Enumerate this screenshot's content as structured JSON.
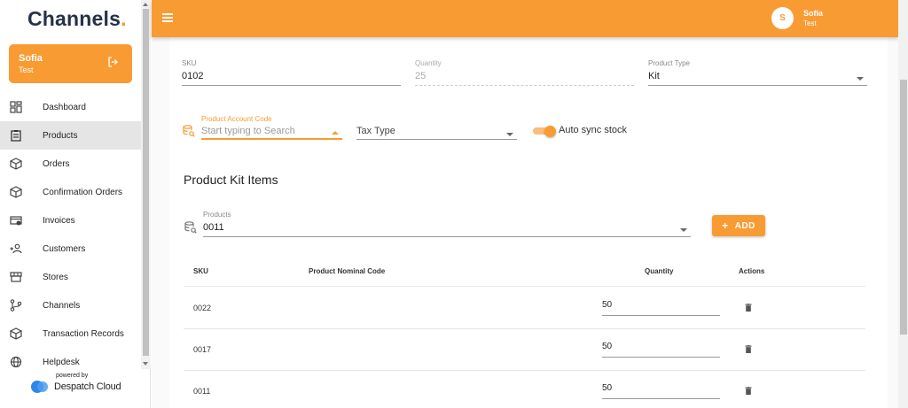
{
  "brand": {
    "name": "Channels",
    "dot": "."
  },
  "user_card": {
    "name": "Sofia",
    "subtitle": "Test"
  },
  "nav": {
    "items": [
      {
        "label": "Dashboard",
        "icon": "dashboard-icon"
      },
      {
        "label": "Products",
        "icon": "clipboard-icon",
        "active": true
      },
      {
        "label": "Orders",
        "icon": "box-icon"
      },
      {
        "label": "Confirmation Orders",
        "icon": "box-icon"
      },
      {
        "label": "Invoices",
        "icon": "invoice-icon"
      },
      {
        "label": "Customers",
        "icon": "add-user-icon"
      },
      {
        "label": "Stores",
        "icon": "store-icon"
      },
      {
        "label": "Channels",
        "icon": "branch-icon"
      },
      {
        "label": "Transaction Records",
        "icon": "box-icon"
      },
      {
        "label": "Helpdesk",
        "icon": "globe-icon"
      }
    ]
  },
  "powered_by": {
    "label": "powered by",
    "brand": "Despatch Cloud"
  },
  "header": {
    "avatar_letter": "S",
    "user_name": "Sofia",
    "user_sub": "Test"
  },
  "form": {
    "sku": {
      "label": "SKU",
      "value": "0102"
    },
    "quantity": {
      "label": "Quantity",
      "value": "25"
    },
    "product_type": {
      "label": "Product Type",
      "value": "Kit"
    },
    "product_account_code": {
      "label": "Product Account Code",
      "placeholder": "Start typing to Search"
    },
    "tax_type": {
      "placeholder": "Tax Type"
    },
    "auto_sync": {
      "label": "Auto sync stock",
      "on": true
    }
  },
  "kit": {
    "title": "Product Kit Items",
    "products": {
      "label": "Products",
      "value": "0011"
    },
    "add_label": "ADD",
    "columns": [
      "SKU",
      "Product Nominal Code",
      "Quantity",
      "Actions"
    ],
    "rows": [
      {
        "sku": "0022",
        "nominal": "",
        "quantity": "50"
      },
      {
        "sku": "0017",
        "nominal": "",
        "quantity": "50"
      },
      {
        "sku": "0011",
        "nominal": "",
        "quantity": "50"
      }
    ]
  },
  "colors": {
    "accent": "#f99b33",
    "brand_dark": "#25324a"
  }
}
